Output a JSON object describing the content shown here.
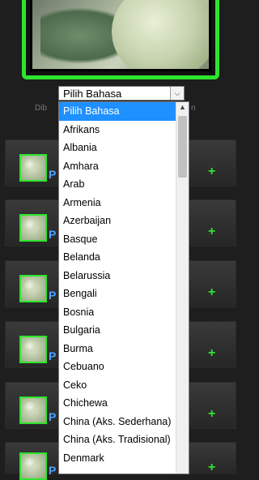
{
  "language_select": {
    "value": "Pilih Bahasa",
    "options": [
      "Pilih Bahasa",
      "Afrikans",
      "Albania",
      "Amhara",
      "Arab",
      "Armenia",
      "Azerbaijan",
      "Basque",
      "Belanda",
      "Belarussia",
      "Bengali",
      "Bosnia",
      "Bulgaria",
      "Burma",
      "Cebuano",
      "Ceko",
      "Chichewa",
      "China (Aks. Sederhana)",
      "China (Aks. Tradisional)",
      "Denmark"
    ],
    "selected_index": 0
  },
  "caption": "Dib",
  "caption_tail": "n",
  "rows": [
    {
      "title": "P",
      "action": "+"
    },
    {
      "title": "P",
      "action": "+"
    },
    {
      "title": "P",
      "action": "+"
    },
    {
      "title": "P",
      "action": "+"
    },
    {
      "title": "P",
      "action": "+"
    },
    {
      "title": "P",
      "action": "+"
    }
  ],
  "colors": {
    "accent_green": "#2de52d",
    "link_blue": "#4aa3ff",
    "selected_bg": "#1e90ff"
  }
}
